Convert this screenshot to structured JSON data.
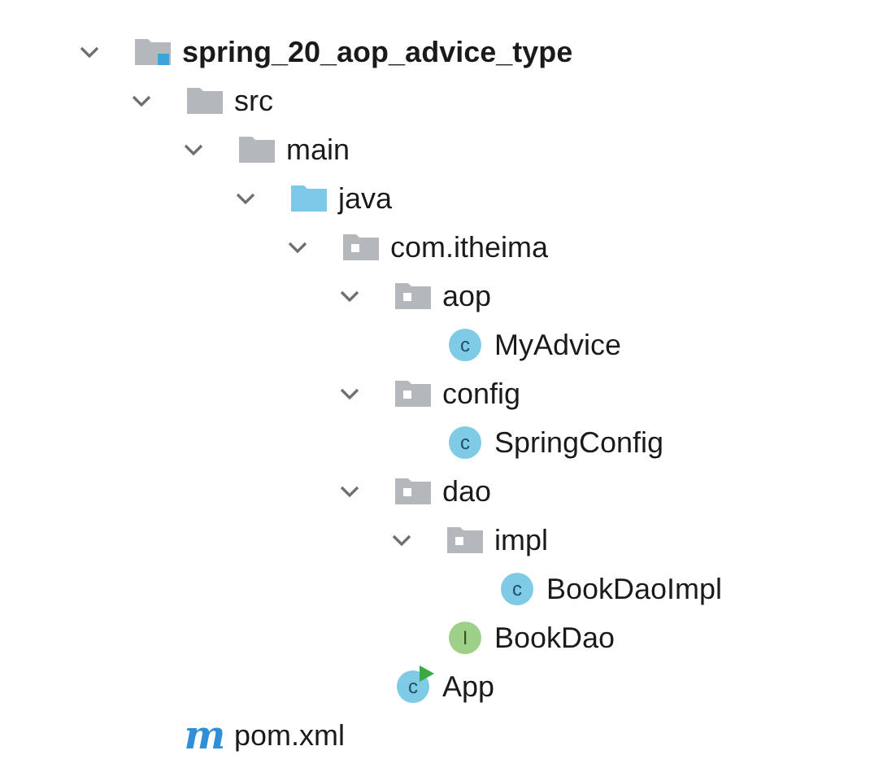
{
  "tree": [
    {
      "kind": "project",
      "label": "spring_20_aop_advice_type",
      "expanded": true,
      "children": [
        {
          "kind": "folder",
          "label": "src",
          "expanded": true,
          "children": [
            {
              "kind": "folder",
              "label": "main",
              "expanded": true,
              "children": [
                {
                  "kind": "source",
                  "label": "java",
                  "expanded": true,
                  "children": [
                    {
                      "kind": "package",
                      "label": "com.itheima",
                      "expanded": true,
                      "children": [
                        {
                          "kind": "package",
                          "label": "aop",
                          "expanded": true,
                          "children": [
                            {
                              "kind": "class",
                              "icon_letter": "c",
                              "label": "MyAdvice"
                            }
                          ]
                        },
                        {
                          "kind": "package",
                          "label": "config",
                          "expanded": true,
                          "children": [
                            {
                              "kind": "class",
                              "icon_letter": "c",
                              "label": "SpringConfig"
                            }
                          ]
                        },
                        {
                          "kind": "package",
                          "label": "dao",
                          "expanded": true,
                          "children": [
                            {
                              "kind": "package",
                              "label": "impl",
                              "expanded": true,
                              "children": [
                                {
                                  "kind": "class",
                                  "icon_letter": "c",
                                  "label": "BookDaoImpl"
                                }
                              ]
                            },
                            {
                              "kind": "interface",
                              "icon_letter": "I",
                              "label": "BookDao"
                            }
                          ]
                        },
                        {
                          "kind": "main_class",
                          "icon_letter": "c",
                          "label": "App"
                        }
                      ]
                    }
                  ]
                }
              ]
            }
          ]
        },
        {
          "kind": "maven",
          "icon_letter": "m",
          "label": "pom.xml"
        }
      ]
    }
  ]
}
